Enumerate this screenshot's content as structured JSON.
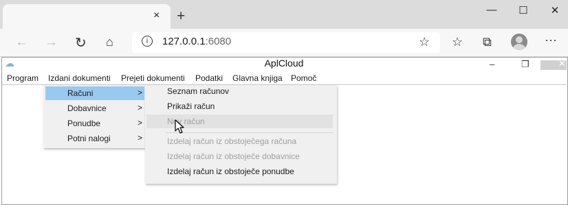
{
  "browser": {
    "tab_close": "×",
    "new_tab": "+",
    "url_host": "127.0.0.1",
    "url_port": ":6080",
    "window_controls": {
      "minimize": "—",
      "maximize": "☐",
      "close": "✕"
    },
    "icons": [
      "back-arrow-icon",
      "forward-arrow-icon",
      "refresh-icon",
      "home-icon",
      "info-icon",
      "star-icon",
      "favorites-icon",
      "collections-icon",
      "profile-avatar",
      "more-icon"
    ]
  },
  "app": {
    "title": "AplCloud",
    "controls": {
      "minimize": "–",
      "restore": "❐"
    },
    "menu": [
      "Program",
      "Izdani dokumenti",
      "Prejeti dokumenti",
      "Podatki",
      "Glavna knjiga",
      "Pomoč"
    ]
  },
  "submenu1": [
    {
      "label": "Računi",
      "arrow": ">",
      "selected": true
    },
    {
      "label": "Dobavnice",
      "arrow": ">"
    },
    {
      "label": "Ponudbe",
      "arrow": ">"
    },
    {
      "label": "Potni nalogi",
      "arrow": ">"
    }
  ],
  "submenu2": [
    {
      "label": "Seznam računov",
      "enabled": true
    },
    {
      "label": "Prikaži račun",
      "enabled": true
    },
    {
      "label": "Nov račun",
      "enabled": false
    },
    {
      "label": "Izdelaj račun iz obstoječega računa",
      "enabled": false
    },
    {
      "label": "Izdelaj račun iz obstoječe dobavnice",
      "enabled": false
    },
    {
      "label": "Izdelaj račun iz obstoječe ponudbe",
      "enabled": true
    }
  ]
}
